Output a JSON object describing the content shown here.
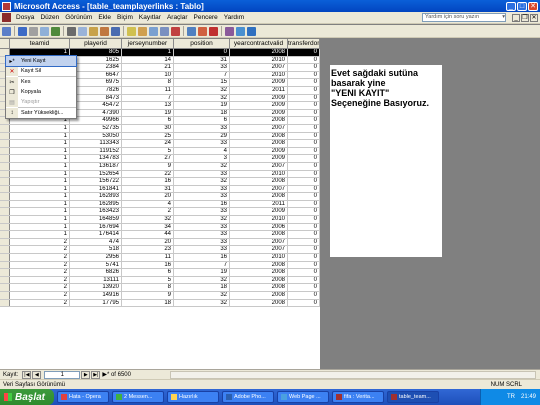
{
  "window": {
    "title": "Microsoft Access - [table_teamplayerlinks : Tablo]"
  },
  "menu": {
    "items": [
      "Dosya",
      "Düzen",
      "Görünüm",
      "Ekle",
      "Biçim",
      "Kayıtlar",
      "Araçlar",
      "Pencere",
      "Yardım"
    ],
    "help_placeholder": "Yardım için soru yazın"
  },
  "table": {
    "columns": [
      "teamid",
      "playerid",
      "jerseynumber",
      "position",
      "yearcontractvalid",
      "transferdone"
    ],
    "rows": [
      [
        "1",
        "805",
        "1",
        "0",
        "2008",
        "0"
      ],
      [
        "1",
        "1625",
        "14",
        "31",
        "2010",
        "0"
      ],
      [
        "1",
        "2384",
        "21",
        "33",
        "2007",
        "0"
      ],
      [
        "1",
        "6647",
        "10",
        "7",
        "2010",
        "0"
      ],
      [
        "1",
        "6975",
        "8",
        "15",
        "2009",
        "0"
      ],
      [
        "1",
        "7826",
        "11",
        "32",
        "2011",
        "0"
      ],
      [
        "1",
        "8473",
        "7",
        "32",
        "2009",
        "0"
      ],
      [
        "1",
        "45472",
        "13",
        "19",
        "2009",
        "0"
      ],
      [
        "1",
        "47390",
        "19",
        "18",
        "2009",
        "0"
      ],
      [
        "1",
        "49966",
        "6",
        "6",
        "2008",
        "0"
      ],
      [
        "1",
        "52735",
        "30",
        "33",
        "2007",
        "0"
      ],
      [
        "1",
        "53050",
        "25",
        "29",
        "2008",
        "0"
      ],
      [
        "1",
        "113343",
        "24",
        "33",
        "2008",
        "0"
      ],
      [
        "1",
        "119152",
        "5",
        "4",
        "2009",
        "0"
      ],
      [
        "1",
        "134783",
        "27",
        "3",
        "2009",
        "0"
      ],
      [
        "1",
        "136187",
        "9",
        "32",
        "2007",
        "0"
      ],
      [
        "1",
        "152654",
        "22",
        "33",
        "2010",
        "0"
      ],
      [
        "1",
        "156722",
        "16",
        "32",
        "2008",
        "0"
      ],
      [
        "1",
        "161841",
        "31",
        "33",
        "2007",
        "0"
      ],
      [
        "1",
        "162893",
        "20",
        "33",
        "2008",
        "0"
      ],
      [
        "1",
        "162895",
        "4",
        "16",
        "2011",
        "0"
      ],
      [
        "1",
        "163423",
        "2",
        "33",
        "2009",
        "0"
      ],
      [
        "1",
        "164859",
        "32",
        "32",
        "2010",
        "0"
      ],
      [
        "1",
        "167694",
        "34",
        "33",
        "2006",
        "0"
      ],
      [
        "1",
        "176414",
        "44",
        "33",
        "2008",
        "0"
      ],
      [
        "2",
        "474",
        "20",
        "33",
        "2007",
        "0"
      ],
      [
        "2",
        "518",
        "23",
        "33",
        "2007",
        "0"
      ],
      [
        "2",
        "2956",
        "11",
        "16",
        "2010",
        "0"
      ],
      [
        "2",
        "5741",
        "16",
        "7",
        "2008",
        "0"
      ],
      [
        "2",
        "6826",
        "6",
        "19",
        "2008",
        "0"
      ],
      [
        "2",
        "13111",
        "5",
        "32",
        "2008",
        "0"
      ],
      [
        "2",
        "13920",
        "8",
        "18",
        "2008",
        "0"
      ],
      [
        "2",
        "14916",
        "9",
        "32",
        "2008",
        "0"
      ],
      [
        "2",
        "17795",
        "18",
        "32",
        "2008",
        "0"
      ]
    ]
  },
  "context_menu": {
    "items": [
      {
        "label": "Yeni Kayıt",
        "icon": "new-record-icon"
      },
      {
        "label": "Kayıt Sil",
        "icon": "delete-record-icon"
      },
      {
        "label": "Kes",
        "icon": "cut-icon"
      },
      {
        "label": "Kopyala",
        "icon": "copy-icon"
      },
      {
        "label": "Yapıştır",
        "icon": "paste-icon"
      },
      {
        "label": "Satır Yüksekliği...",
        "icon": "row-height-icon"
      }
    ]
  },
  "annotation": {
    "lines": [
      "Evet sağdaki sutüna",
      "basarak yine",
      "\"YENI KAYIT\"",
      "Seçeneğine Basıyoruz."
    ]
  },
  "nav": {
    "label": "Kayıt:",
    "current": "1",
    "total": "▶* of 6500"
  },
  "status": {
    "left": "Veri Sayfası Görünümü",
    "right": "NUM  SCRL"
  },
  "taskbar": {
    "start": "Başlat",
    "tasks": [
      "Hata - Opera",
      "2 Messen...",
      "Hazırlık",
      "Adobe Pho...",
      "Web Page ...",
      "fifa : Verita...",
      "table_team..."
    ],
    "lang": "TR",
    "time": "21:49"
  },
  "colors": {
    "title_bar": "#0a5fd8",
    "chrome": "#ece9d8",
    "selection": "#000000",
    "menu_highlight": "#c1d2ee"
  }
}
